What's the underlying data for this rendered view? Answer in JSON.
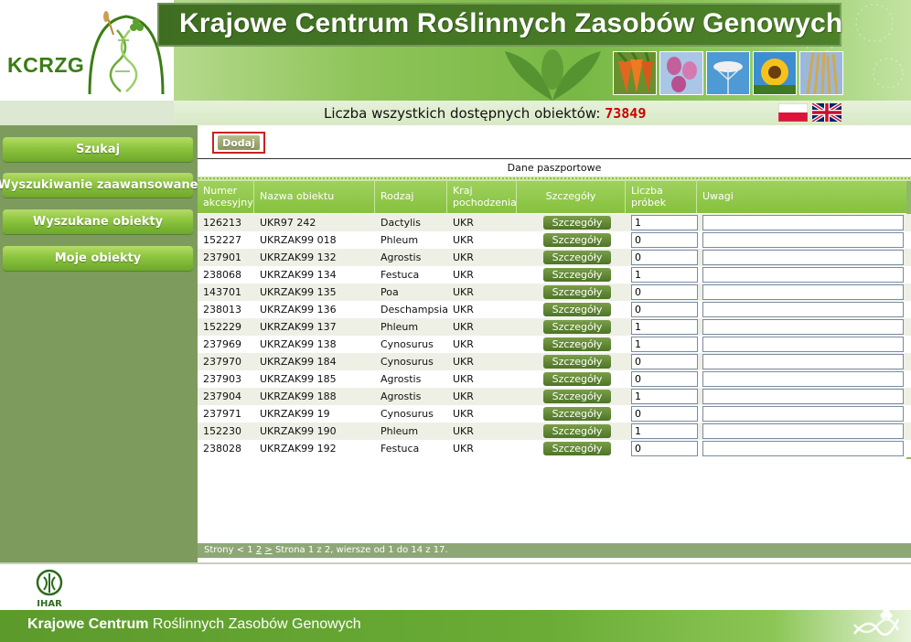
{
  "header": {
    "logo_text": "KCRZG",
    "site_title": "Krajowe Centrum Roślinnych Zasobów Genowych",
    "count_label": "Liczba wszystkich dostępnych obiektów: ",
    "count_value": "73849"
  },
  "sidebar": {
    "items": [
      {
        "label": "Szukaj"
      },
      {
        "label": "Wyszukiwanie zaawansowane"
      },
      {
        "label": "Wyszukane obiekty"
      },
      {
        "label": "Moje obiekty"
      }
    ]
  },
  "toolbar": {
    "add_label": "Dodaj"
  },
  "table": {
    "title": "Dane paszportowe",
    "headers": {
      "accession_1": "Numer",
      "accession_2": "akcesyjny",
      "name": "Nazwa obiektu",
      "genus": "Rodzaj",
      "country_1": "Kraj",
      "country_2": "pochodzenia",
      "details": "Szczegóły",
      "samples_1": "Liczba",
      "samples_2": "próbek",
      "remarks": "Uwagi"
    },
    "details_button": "Szczegóły",
    "rows": [
      {
        "acc": "126213",
        "name": "UKR97 242",
        "genus": "Dactylis",
        "country": "UKR",
        "samples": "1",
        "remarks": ""
      },
      {
        "acc": "152227",
        "name": "UKRZAK99 018",
        "genus": "Phleum",
        "country": "UKR",
        "samples": "0",
        "remarks": ""
      },
      {
        "acc": "237901",
        "name": "UKRZAK99 132",
        "genus": "Agrostis",
        "country": "UKR",
        "samples": "0",
        "remarks": ""
      },
      {
        "acc": "238068",
        "name": "UKRZAK99 134",
        "genus": "Festuca",
        "country": "UKR",
        "samples": "1",
        "remarks": ""
      },
      {
        "acc": "143701",
        "name": "UKRZAK99 135",
        "genus": "Poa",
        "country": "UKR",
        "samples": "0",
        "remarks": ""
      },
      {
        "acc": "238013",
        "name": "UKRZAK99 136",
        "genus": "Deschampsia",
        "country": "UKR",
        "samples": "0",
        "remarks": ""
      },
      {
        "acc": "152229",
        "name": "UKRZAK99 137",
        "genus": "Phleum",
        "country": "UKR",
        "samples": "1",
        "remarks": ""
      },
      {
        "acc": "237969",
        "name": "UKRZAK99 138",
        "genus": "Cynosurus",
        "country": "UKR",
        "samples": "1",
        "remarks": ""
      },
      {
        "acc": "237970",
        "name": "UKRZAK99 184",
        "genus": "Cynosurus",
        "country": "UKR",
        "samples": "0",
        "remarks": ""
      },
      {
        "acc": "237903",
        "name": "UKRZAK99 185",
        "genus": "Agrostis",
        "country": "UKR",
        "samples": "0",
        "remarks": ""
      },
      {
        "acc": "237904",
        "name": "UKRZAK99 188",
        "genus": "Agrostis",
        "country": "UKR",
        "samples": "1",
        "remarks": ""
      },
      {
        "acc": "237971",
        "name": "UKRZAK99 19",
        "genus": "Cynosurus",
        "country": "UKR",
        "samples": "0",
        "remarks": ""
      },
      {
        "acc": "152230",
        "name": "UKRZAK99 190",
        "genus": "Phleum",
        "country": "UKR",
        "samples": "1",
        "remarks": ""
      },
      {
        "acc": "238028",
        "name": "UKRZAK99 192",
        "genus": "Festuca",
        "country": "UKR",
        "samples": "0",
        "remarks": ""
      }
    ]
  },
  "pager": {
    "prefix": "Strony < 1 ",
    "page2": "2",
    "next": ">",
    "status": " Strona 1 z 2, wiersze od 1 do 14 z 17."
  },
  "footer": {
    "ihar_logo_text": "IHAR",
    "title_bold": "Krajowe Centrum ",
    "title_rest": "Roślinnych Zasobów Genowych"
  },
  "colors": {
    "accent_green": "#86c13e",
    "sidebar_bg": "#7d9b5d",
    "count_red": "#cc0000",
    "title_bar": "#3f6e22"
  }
}
